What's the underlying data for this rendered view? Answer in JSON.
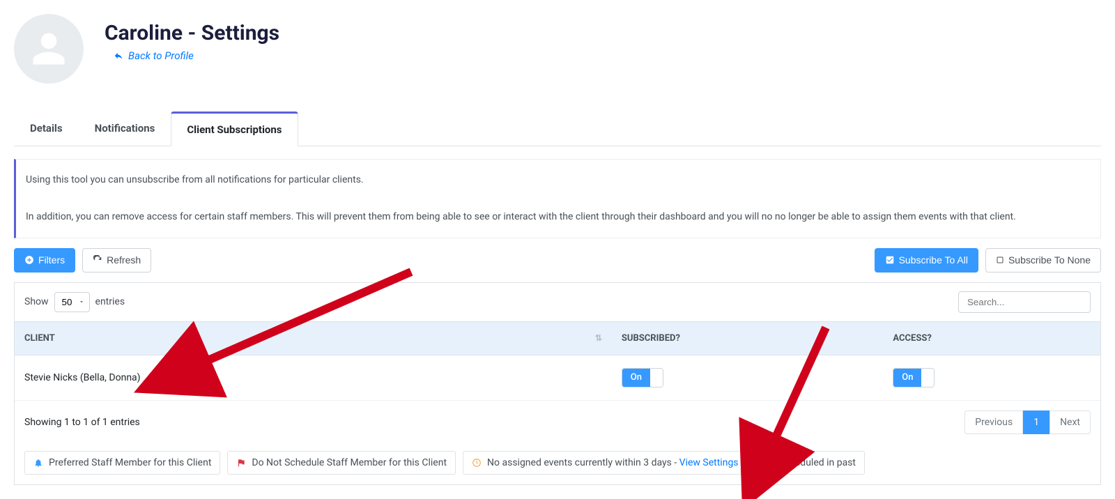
{
  "header": {
    "title": "Caroline - Settings",
    "back_label": "Back to Profile"
  },
  "tabs": {
    "details": "Details",
    "notifications": "Notifications",
    "subscriptions": "Client Subscriptions"
  },
  "info": {
    "line1": "Using this tool you can unsubscribe from all notifications for particular clients.",
    "line2": "In addition, you can remove access for certain staff members. This will prevent them from being able to see or interact with the client through their dashboard and you will no no longer be able to assign them events with that client."
  },
  "toolbar": {
    "filters": "Filters",
    "refresh": "Refresh",
    "subscribe_all": "Subscribe To All",
    "subscribe_none": "Subscribe To None"
  },
  "datatable": {
    "show_label": "Show",
    "entries_label": "entries",
    "page_size": "50",
    "search_placeholder": "Search...",
    "cols": {
      "client": "CLIENT",
      "subscribed": "SUBSCRIBED?",
      "access": "ACCESS?"
    },
    "rows": [
      {
        "client_name": "Stevie Nicks (Bella, Donna)",
        "subscribed": "On",
        "access": "On"
      }
    ],
    "showing": "Showing 1 to 1 of 1 entries",
    "prev": "Previous",
    "page": "1",
    "next": "Next"
  },
  "legend": {
    "preferred": "Preferred Staff Member for this Client",
    "do_not_schedule": "Do Not Schedule Staff Member for this Client",
    "no_events_prefix": "No assigned events currently within 3 days - ",
    "view_settings": "View Settings",
    "scheduled_past": "Scheduled in past"
  },
  "colors": {
    "primary": "#3699ff",
    "accent": "#5b5fd6",
    "bell": "#3699ff",
    "clock": "#f0ad4e",
    "calendar": "#28a745",
    "flag": "#dc3545",
    "arrow": "#d0021b"
  }
}
